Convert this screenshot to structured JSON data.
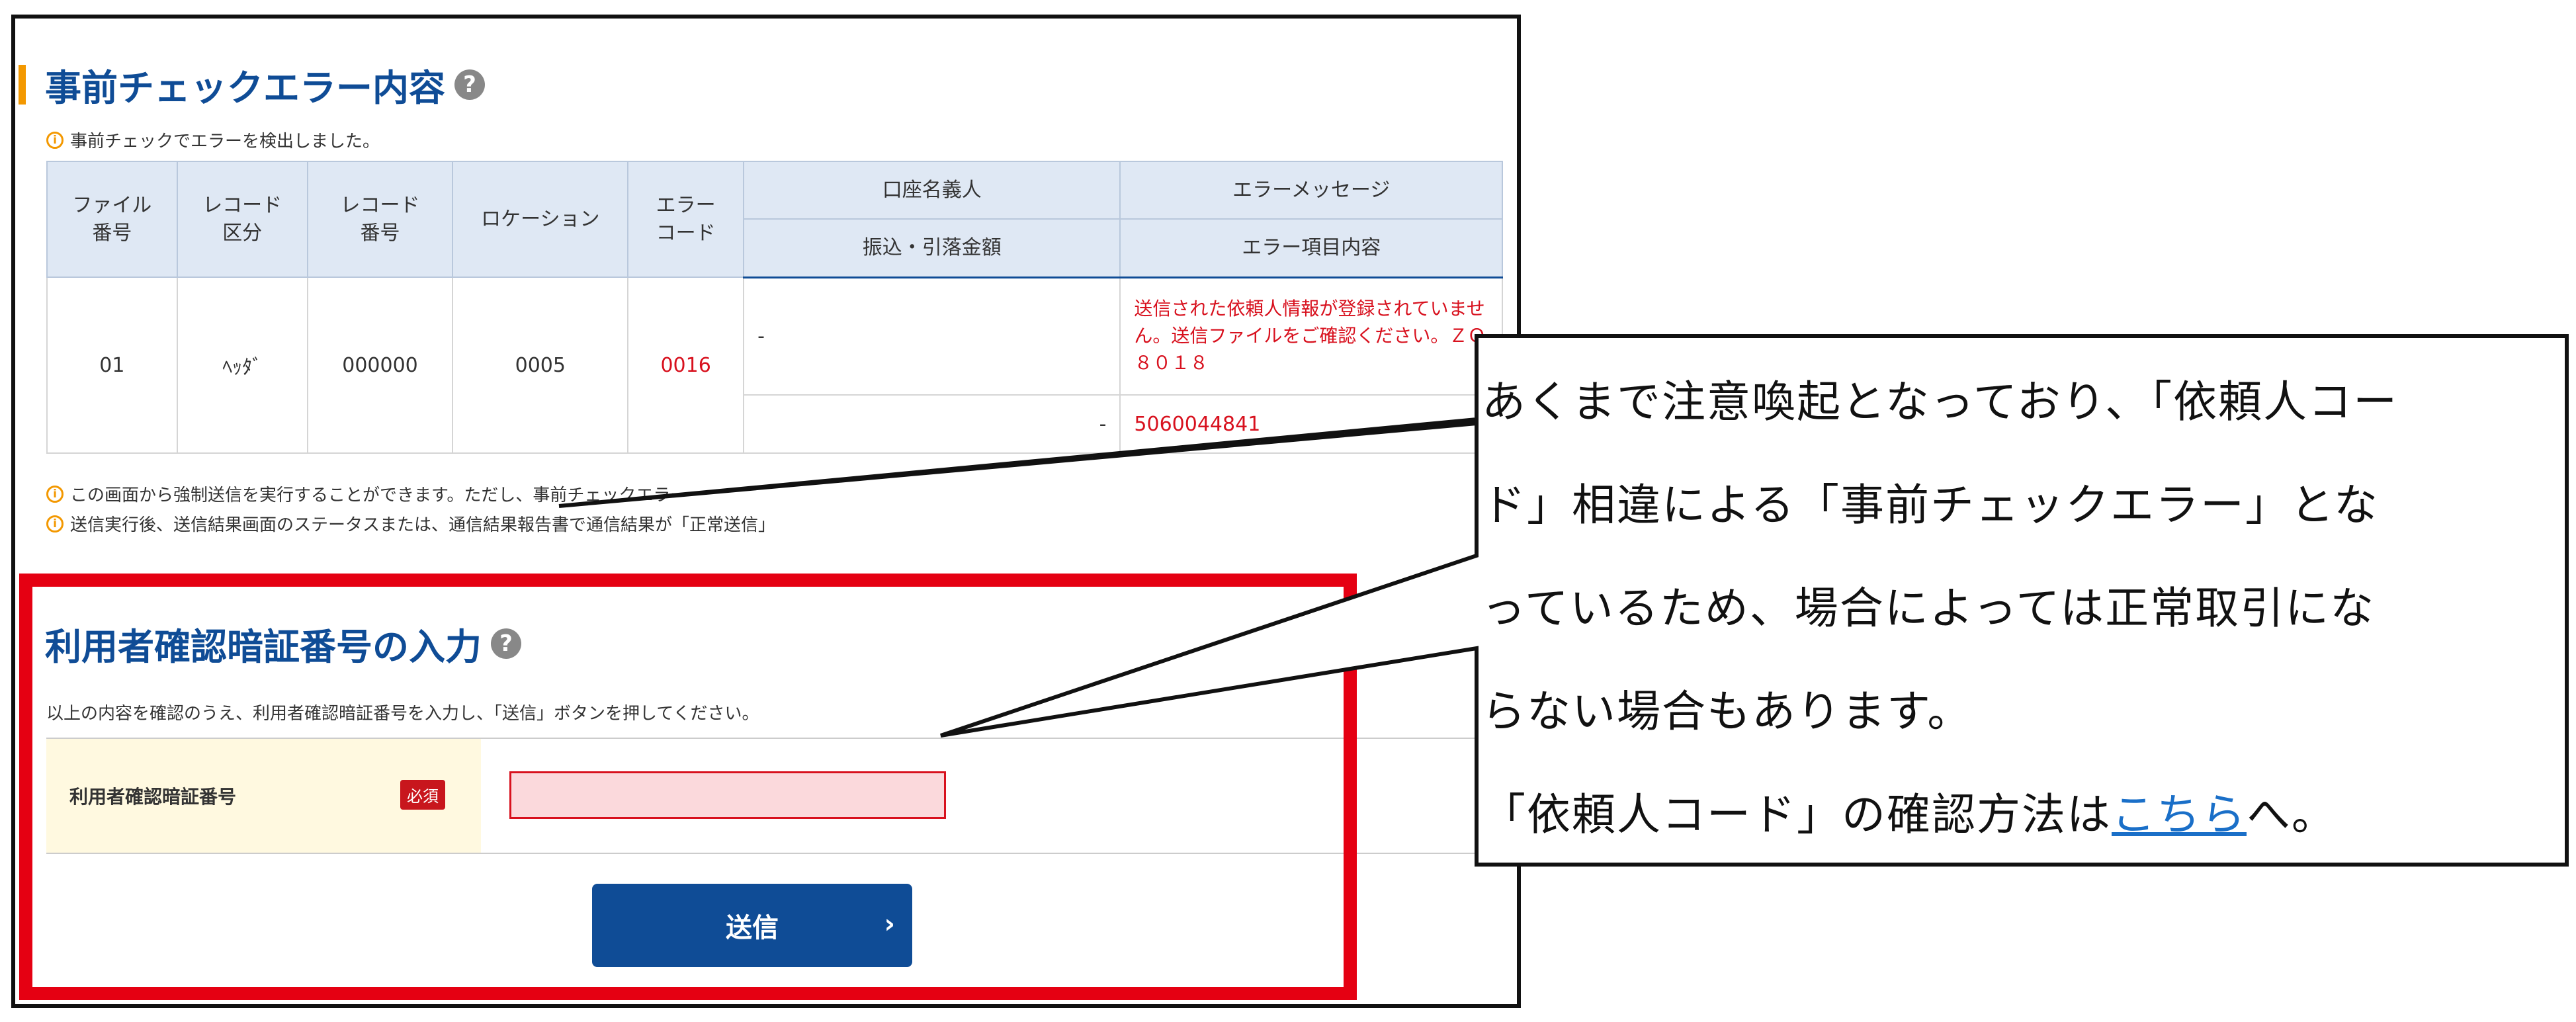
{
  "error_section": {
    "title": "事前チェックエラー内容",
    "help": "?",
    "info_icon": "i",
    "info": "事前チェックでエラーを検出しました。"
  },
  "table": {
    "headers": {
      "file_no": "ファイル\n番号",
      "record_type": "レコード\n区分",
      "record_no": "レコード\n番号",
      "location": "ロケーション",
      "error_code": "エラー\nコード",
      "account_name": "口座名義人",
      "amount": "振込・引落金額",
      "error_message": "エラーメッセージ",
      "error_item": "エラー項目内容"
    },
    "row": {
      "file_no": "01",
      "record_type": "ﾍｯﾀﾞ",
      "record_no": "000000",
      "location": "0005",
      "error_code": "0016",
      "account_name": "-",
      "amount": "-",
      "error_message": "送信された依頼人情報が登録されていません。送信ファイルをご確認ください。ＺＯ８０１８",
      "error_item": "5060044841"
    }
  },
  "notes": {
    "note1": "この画面から強制送信を実行することができます。ただし、事前チェックエラー",
    "note2": "送信実行後、送信結果画面のステータスまたは、通信結果報告書で通信結果が「正常送信」"
  },
  "pin_section": {
    "title": "利用者確認暗証番号の入力",
    "help": "?",
    "instructions": "以上の内容を確認のうえ、利用者確認暗証番号を入力し、「送信」ボタンを押してください。",
    "field_label": "利用者確認暗証番号",
    "required_badge": "必須",
    "input_value": "",
    "send_label": "送信",
    "send_chevron": "›"
  },
  "callout": {
    "line1": "あくまで注意喚起となっており、「依頼人コー",
    "line2": "ド」相違による「事前チェックエラー」とな",
    "line3": "っているため、場合によっては正常取引にな",
    "line4": "らない場合もあります。",
    "line5_prefix": "「依頼人コード」の確認方法は",
    "line5_link": "こちら",
    "line5_suffix": "へ。"
  },
  "colors": {
    "brand_blue": "#0f4c96",
    "accent_orange": "#f39800",
    "error_red": "#d8111e",
    "highlight_red": "#e50012",
    "table_header": "#dfe8f4",
    "required_bg": "#fff9e0"
  }
}
